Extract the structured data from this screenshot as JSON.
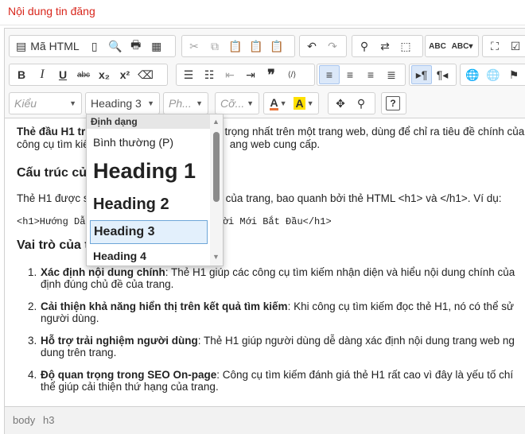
{
  "section_title": "Nội dung tin đăng",
  "toolbar": {
    "source_label": "Mã HTML",
    "row1_icons": [
      "source-icon",
      "new-page-icon",
      "preview-icon",
      "print-icon",
      "templates-icon",
      "cut-icon",
      "copy-icon",
      "paste-icon",
      "paste-text-icon",
      "paste-word-icon",
      "undo-icon",
      "redo-icon",
      "find-icon",
      "replace-icon",
      "select-all-icon",
      "spellcheck-icon",
      "scayt-icon",
      "show-blocks-icon",
      "checkbox-icon"
    ],
    "row2_icons": [
      "bold-icon",
      "italic-icon",
      "underline-icon",
      "strike-icon",
      "subscript-icon",
      "superscript-icon",
      "remove-format-icon",
      "numbered-list-icon",
      "bulleted-list-icon",
      "outdent-icon",
      "indent-icon",
      "blockquote-icon",
      "create-div-icon",
      "align-left-icon",
      "align-center-icon",
      "align-right-icon",
      "justify-icon",
      "ltr-icon",
      "rtl-icon",
      "link-icon",
      "unlink-icon",
      "anchor-icon"
    ],
    "styles_placeholder": "Kiểu",
    "format_value": "Heading 3",
    "font_placeholder": "Ph...",
    "size_placeholder": "Cỡ...",
    "text_color_label": "A",
    "bg_color_label": "A",
    "accent": "#d8261c"
  },
  "format_dropdown": {
    "header": "Định dạng",
    "items": [
      {
        "label": "Bình thường (P)"
      },
      {
        "label": "Heading 1"
      },
      {
        "label": "Heading 2"
      },
      {
        "label": "Heading 3",
        "selected": true
      },
      {
        "label": "Heading 4"
      }
    ]
  },
  "content": {
    "p1_bold": "Thẻ đầu  H1 tr",
    "p1_rest": "n trọng nhất trên một trang web, dùng để chỉ ra tiêu đề chính của",
    "p1_line2a": "công cụ tìm kiế",
    "p1_line2b": "ang web cung cấp.",
    "h_structure": "Cấu trúc củ",
    "p2a": "Thẻ H1 được s",
    "p2b": "của trang, bao quanh bởi thẻ HTML <h1> và </h1>. Ví dụ:",
    "code_a": "<h1>Hướng Dẫ",
    "code_b": "gười Mới Bắt Đầu</h1>",
    "h_role": "Vai trò của t",
    "list": [
      {
        "num": "1.",
        "bold": "Xác định nội dung chính",
        "rest": ": Thẻ H1 giúp các công cụ tìm kiếm nhận diện và hiểu nội dung chính của",
        "line2": "định đúng chủ đề của trang."
      },
      {
        "num": "2.",
        "bold": "Cải thiện khả năng hiển thị trên kết quả tìm kiếm",
        "rest": ": Khi công cụ tìm kiếm đọc thẻ H1, nó có thể sử",
        "line2": "người dùng."
      },
      {
        "num": "3.",
        "bold": "Hỗ trợ trải nghiệm người dùng",
        "rest": ": Thẻ H1 giúp người dùng dễ dàng xác định nội dung trang web ng",
        "line2": "dung trên trang."
      },
      {
        "num": "4.",
        "bold": "Độ quan trọng trong SEO On-page",
        "rest": ": Công cụ tìm kiếm đánh giá thẻ H1 rất cao vì đây là yếu tố chí",
        "line2": "thể giúp cải thiện thứ hạng của trang."
      }
    ]
  },
  "status_path": [
    "body",
    "h3"
  ]
}
